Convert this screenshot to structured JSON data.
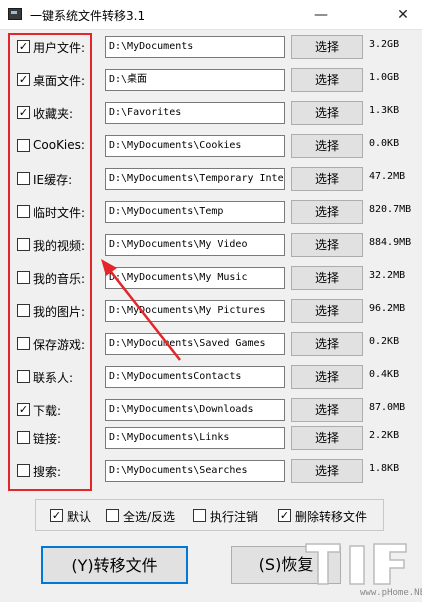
{
  "window": {
    "title": "一键系统文件转移3.1",
    "minimize": "—",
    "close": "✕"
  },
  "rows": [
    {
      "label": "用户文件:",
      "checked": true,
      "path": "D:\\MyDocuments",
      "button": "选择",
      "size": "3.2GB"
    },
    {
      "label": "桌面文件:",
      "checked": true,
      "path": "D:\\桌面",
      "button": "选择",
      "size": "1.0GB"
    },
    {
      "label": "收藏夹:",
      "checked": true,
      "path": "D:\\Favorites",
      "button": "选择",
      "size": "1.3KB"
    },
    {
      "label": "CooKies:",
      "checked": false,
      "path": "D:\\MyDocuments\\Cookies",
      "button": "选择",
      "size": "0.0KB"
    },
    {
      "label": "IE缓存:",
      "checked": false,
      "path": "D:\\MyDocuments\\Temporary Inte",
      "button": "选择",
      "size": "47.2MB"
    },
    {
      "label": "临时文件:",
      "checked": false,
      "path": "D:\\MyDocuments\\Temp",
      "button": "选择",
      "size": "820.7MB"
    },
    {
      "label": "我的视频:",
      "checked": false,
      "path": "D:\\MyDocuments\\My Video",
      "button": "选择",
      "size": "884.9MB"
    },
    {
      "label": "我的音乐:",
      "checked": false,
      "path": "D:\\MyDocuments\\My Music",
      "button": "选择",
      "size": "32.2MB"
    },
    {
      "label": "我的图片:",
      "checked": false,
      "path": "D:\\MyDocuments\\My Pictures",
      "button": "选择",
      "size": "96.2MB"
    },
    {
      "label": "保存游戏:",
      "checked": false,
      "path": "D:\\MyDocuments\\Saved Games",
      "button": "选择",
      "size": "0.2KB"
    },
    {
      "label": "联系人:",
      "checked": false,
      "path": "D:\\MyDocumentsContacts",
      "button": "选择",
      "size": "0.4KB"
    },
    {
      "label": "下载:",
      "checked": true,
      "path": "D:\\MyDocuments\\Downloads",
      "button": "选择",
      "size": "87.0MB"
    },
    {
      "label": "链接:",
      "checked": false,
      "path": "D:\\MyDocuments\\Links",
      "button": "选择",
      "size": "2.2KB"
    },
    {
      "label": "搜索:",
      "checked": false,
      "path": "D:\\MyDocuments\\Searches",
      "button": "选择",
      "size": "1.8KB"
    }
  ],
  "options": [
    {
      "label": "默认",
      "checked": true
    },
    {
      "label": "全选/反选",
      "checked": false
    },
    {
      "label": "执行注销",
      "checked": false
    },
    {
      "label": "删除转移文件",
      "checked": true
    }
  ],
  "actions": {
    "transfer": "(Y)转移文件",
    "restore": "(S)恢复"
  },
  "watermark": {
    "url": "www.pHome.NET"
  },
  "colors": {
    "highlight": "#e3262b",
    "focus": "#0078d7"
  }
}
